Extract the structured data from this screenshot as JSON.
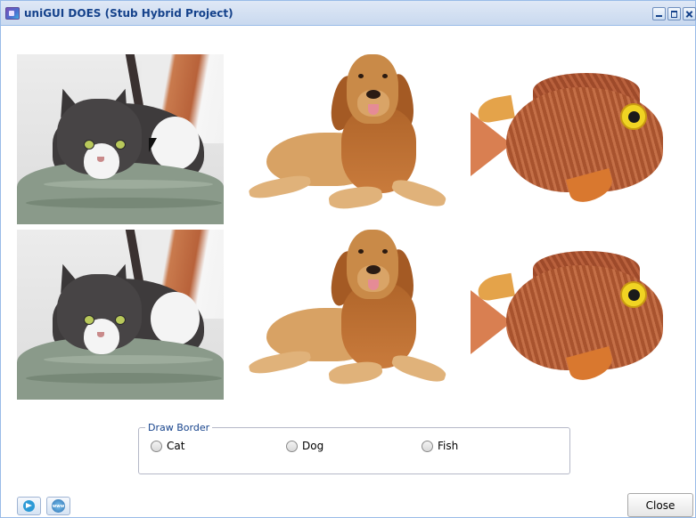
{
  "window": {
    "title": "uniGUI DOES (Stub Hybrid Project)",
    "icon": "app-icon",
    "tools": [
      "minimize-icon",
      "maximize-icon",
      "close-icon"
    ]
  },
  "images": {
    "row1": [
      "cat",
      "dog",
      "fish"
    ],
    "row2": [
      "cat",
      "dog",
      "fish"
    ]
  },
  "draw_border": {
    "legend": "Draw Border",
    "options": [
      {
        "label": "Cat",
        "checked": false
      },
      {
        "label": "Dog",
        "checked": false
      },
      {
        "label": "Fish",
        "checked": false
      }
    ]
  },
  "footer": {
    "left_buttons": [
      "send-icon",
      "www-icon"
    ],
    "www_text": "www",
    "close_label": "Close"
  },
  "colors": {
    "title_text": "#15428b",
    "titlebar": "#dfe8f6",
    "border": "#99bbe8"
  }
}
